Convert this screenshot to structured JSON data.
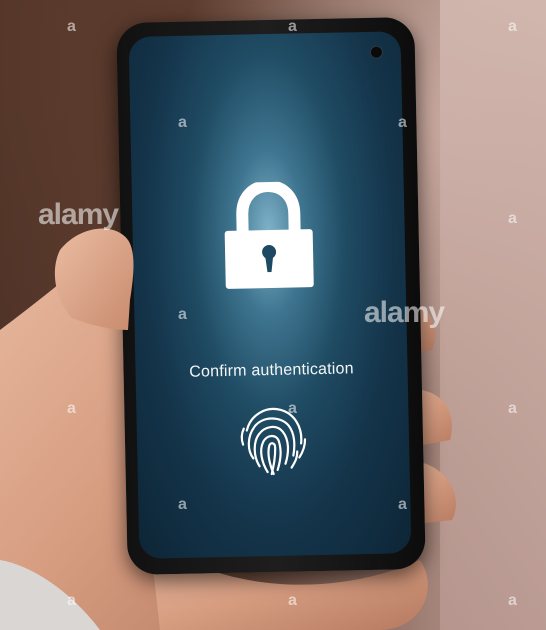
{
  "screen": {
    "prompt": "Confirm authentication"
  },
  "icons": {
    "lock": "padlock-icon",
    "fingerprint": "fingerprint-icon"
  },
  "watermark": {
    "brand": "alamy",
    "mark": "a"
  },
  "colors": {
    "screen_glow": "#7fb3c9",
    "screen_dark": "#0d2536",
    "icon_white": "#ffffff"
  }
}
